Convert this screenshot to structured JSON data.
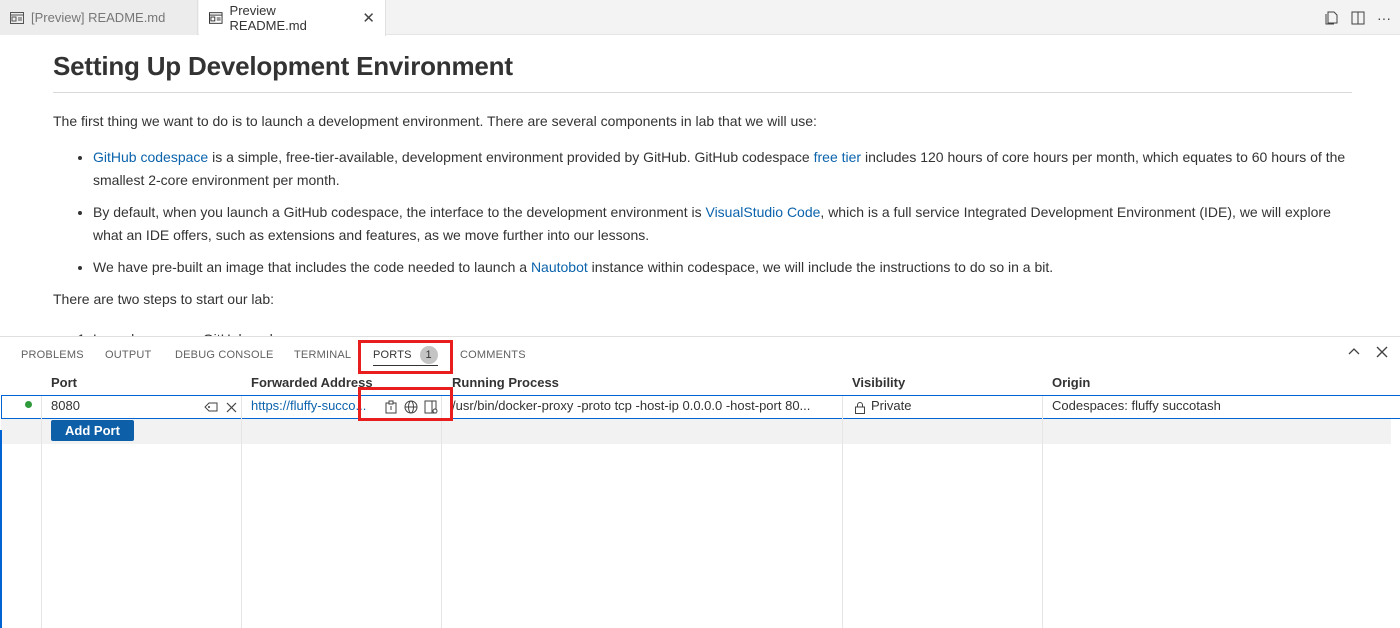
{
  "tabs": [
    {
      "label": "[Preview] README.md",
      "active": false
    },
    {
      "label": "Preview README.md",
      "active": true,
      "close": "✕"
    }
  ],
  "editor_actions": [
    "open-source-icon",
    "split-editor-icon",
    "more-icon"
  ],
  "document": {
    "title": "Setting Up Development Environment",
    "intro": "The first thing we want to do is to launch a development environment. There are several components in lab that we will use:",
    "bullets": [
      {
        "link1": "GitHub codespace",
        "text1": " is a simple, free-tier-available, development environment provided by GitHub. GitHub codespace ",
        "link2": "free tier",
        "text2": " includes 120 hours of core hours per month, which equates to 60 hours of the smallest 2-core environment per month."
      },
      {
        "text1": "By default, when you launch a GitHub codespace, the interface to the development environment is ",
        "link1": "VisualStudio Code",
        "text2": ", which is a full service Integrated Development Environment (IDE), we will explore what an IDE offers, such as extensions and features, as we move further into our lessons."
      },
      {
        "text1": "We have pre-built an image that includes the code needed to launch a ",
        "link1": "Nautobot",
        "text2": " instance within codespace, we will include the instructions to do so in a bit."
      }
    ],
    "steps_intro": "There are two steps to start our lab:",
    "step1_partial": "Launch a new, ... GitHub codespace"
  },
  "panel": {
    "tabs": [
      "PROBLEMS",
      "OUTPUT",
      "DEBUG CONSOLE",
      "TERMINAL",
      "PORTS",
      "COMMENTS"
    ],
    "active_tab": "PORTS",
    "ports_badge": "1",
    "columns": [
      "Port",
      "Forwarded Address",
      "Running Process",
      "Visibility",
      "Origin"
    ],
    "rows": [
      {
        "status": "running",
        "port": "8080",
        "address": "https://fluffy-succo...",
        "process": "/usr/bin/docker-proxy -proto tcp -host-ip 0.0.0.0 -host-port 80...",
        "visibility": "Private",
        "origin": "Codespaces: fluffy succotash"
      }
    ],
    "add_port_label": "Add Port"
  },
  "colors": {
    "link": "#0b63ac",
    "highlight": "#e81e1e",
    "focus": "#0064d2",
    "status_ok": "#2e9a3c",
    "button": "#0d5fa8"
  }
}
